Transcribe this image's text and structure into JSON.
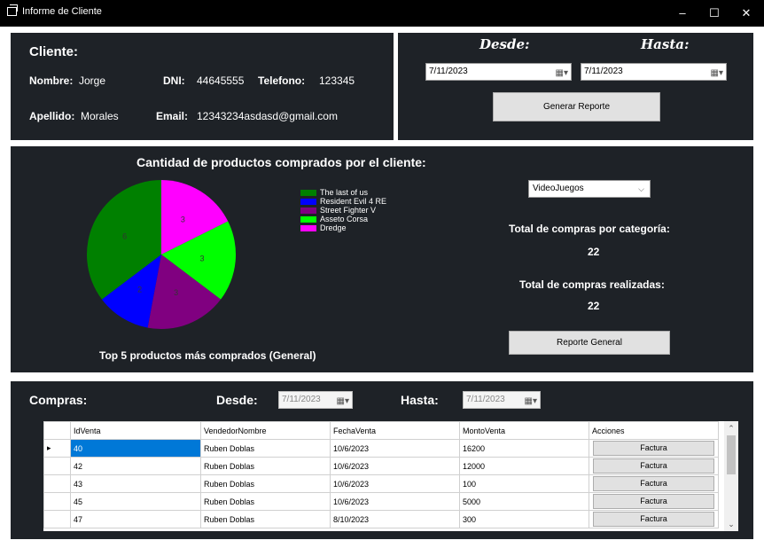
{
  "window": {
    "title": "Informe de Cliente",
    "minimize": "–",
    "maximize": "☐",
    "close": "✕"
  },
  "cliente": {
    "heading": "Cliente:",
    "nombre_label": "Nombre:",
    "nombre_value": "Jorge",
    "apellido_label": "Apellido:",
    "apellido_value": "Morales",
    "dni_label": "DNI:",
    "dni_value": "44645555",
    "telefono_label": "Telefono:",
    "telefono_value": "123345",
    "email_label": "Email:",
    "email_value": "12343234asdasd@gmail.com"
  },
  "reporte": {
    "desde_label": "Desde:",
    "hasta_label": "Hasta:",
    "desde_value": "7/11/2023",
    "hasta_value": "7/11/2023",
    "generar_button": "Generar Reporte"
  },
  "chart": {
    "heading": "Cantidad de productos comprados por el cliente:",
    "footer": "Top 5 productos más comprados (General)"
  },
  "chart_data": {
    "type": "pie",
    "series": [
      {
        "name": "The last of us",
        "value": 6,
        "color": "#008000"
      },
      {
        "name": "Resident Evil 4 RE",
        "value": 2,
        "color": "#0000ff"
      },
      {
        "name": "Street Fighter V",
        "value": 3,
        "color": "#800080"
      },
      {
        "name": "Asseto Corsa",
        "value": 3,
        "color": "#00ff00"
      },
      {
        "name": "Dredge",
        "value": 3,
        "color": "#ff00ff"
      }
    ]
  },
  "categoria": {
    "selected": "VideoJuegos",
    "total_categoria_label": "Total de compras por categoría:",
    "total_categoria_value": "22",
    "total_realizadas_label": "Total de compras realizadas:",
    "total_realizadas_value": "22",
    "reporte_general_button": "Reporte General"
  },
  "compras": {
    "heading": "Compras:",
    "desde_label": "Desde:",
    "desde_value": "7/11/2023",
    "hasta_label": "Hasta:",
    "hasta_value": "7/11/2023",
    "columns": [
      "IdVenta",
      "VendedorNombre",
      "FechaVenta",
      "MontoVenta",
      "Acciones"
    ],
    "rows": [
      {
        "id": "40",
        "vendedor": "Ruben Doblas",
        "fecha": "10/6/2023",
        "monto": "16200",
        "accion": "Factura"
      },
      {
        "id": "42",
        "vendedor": "Ruben Doblas",
        "fecha": "10/6/2023",
        "monto": "12000",
        "accion": "Factura"
      },
      {
        "id": "43",
        "vendedor": "Ruben Doblas",
        "fecha": "10/6/2023",
        "monto": "100",
        "accion": "Factura"
      },
      {
        "id": "45",
        "vendedor": "Ruben Doblas",
        "fecha": "10/6/2023",
        "monto": "5000",
        "accion": "Factura"
      },
      {
        "id": "47",
        "vendedor": "Ruben Doblas",
        "fecha": "8/10/2023",
        "monto": "300",
        "accion": "Factura"
      }
    ]
  }
}
